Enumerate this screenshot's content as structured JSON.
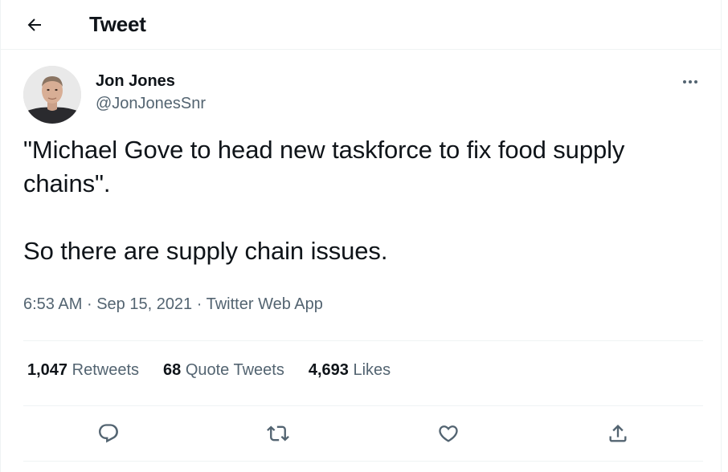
{
  "header": {
    "title": "Tweet",
    "back_icon": "arrow-left-icon"
  },
  "tweet": {
    "author": {
      "display_name": "Jon Jones",
      "handle": "@JonJonesSnr"
    },
    "text_lines": [
      "\"Michael Gove to head new taskforce to fix food supply chains\".",
      "So there are supply chain issues."
    ],
    "time": "6:53 AM",
    "separator": "·",
    "date": "Sep 15, 2021",
    "source": "Twitter Web App"
  },
  "stats": {
    "retweets_count": "1,047",
    "retweets_label": "Retweets",
    "quotes_count": "68",
    "quotes_label": "Quote Tweets",
    "likes_count": "4,693",
    "likes_label": "Likes"
  },
  "actions": [
    {
      "name": "reply",
      "icon": "reply-icon"
    },
    {
      "name": "retweet",
      "icon": "retweet-icon"
    },
    {
      "name": "like",
      "icon": "heart-icon"
    },
    {
      "name": "share",
      "icon": "share-icon"
    }
  ],
  "colors": {
    "text_primary": "#0f1419",
    "text_secondary": "#536471",
    "border": "#eff3f4"
  }
}
